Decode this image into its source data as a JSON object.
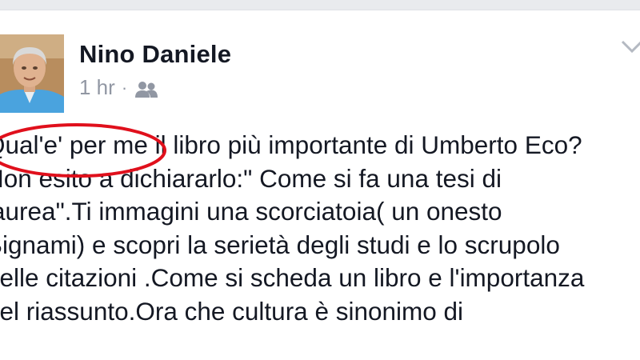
{
  "post": {
    "author": "Nino Daniele",
    "timestamp": "1 hr",
    "separator": "·",
    "audience_icon": "friends-icon",
    "menu_icon": "chevron-down-icon",
    "lines": [
      "Qual'e' per me il libro più importante di Umberto Eco?",
      "Non esito a dichiararlo:\" Come si fa una tesi di",
      "laurea\".Ti immagini una scorciatoia( un onesto",
      "Bignami) e scopri la serietà degli studi e lo scrupolo",
      "delle citazioni .Come si scheda un libro e l'importanza",
      "del riassunto.Ora che cultura è sinonimo di"
    ]
  },
  "annotation": {
    "shape": "ellipse",
    "color": "#e0101c"
  },
  "colors": {
    "name_text": "#141823",
    "meta_text": "#9197a3",
    "top_strip": "#e9ebee"
  }
}
